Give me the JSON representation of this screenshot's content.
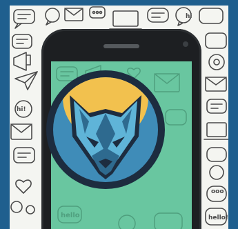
{
  "colors": {
    "frame_blue": "#1f5f8e",
    "paper": "#f4f5f1",
    "doodle_ink": "#4a4a4a",
    "phone_body": "#1d1f22",
    "screen_green": "#69c6a0",
    "emblem_ring": "#1d2c3f",
    "sun_yellow": "#f2c14e",
    "sky_blue": "#3f8cb8",
    "wolf_light": "#5fb4d8",
    "wolf_dark": "#2e6a8f"
  },
  "doodles": {
    "top_right_word": "hi",
    "left_word": "hi!",
    "bottom_left_word": "hello",
    "bottom_right_word": "hello!",
    "right_word": "ooo"
  },
  "icons": [
    "chat-bubble-icon",
    "paper-plane-icon",
    "envelope-icon",
    "heart-icon",
    "laptop-icon",
    "megaphone-icon",
    "wolf-logo-icon"
  ]
}
